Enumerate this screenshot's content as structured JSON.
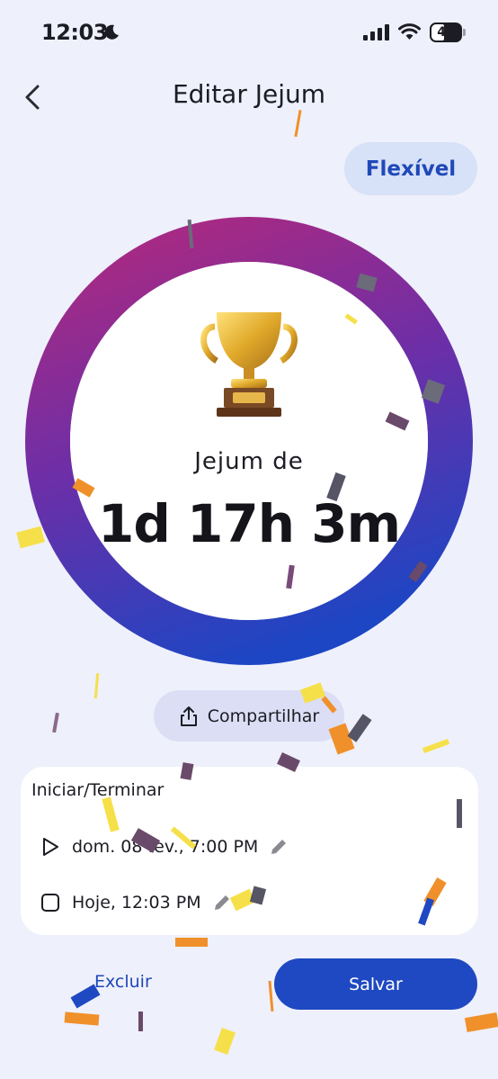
{
  "status_bar": {
    "time": "12:03",
    "battery": "40",
    "icons": [
      "moon-icon",
      "signal-icon",
      "wifi-icon",
      "battery-icon"
    ]
  },
  "header": {
    "title": "Editar Jejum",
    "back_icon": "chevron-left-icon"
  },
  "mode": {
    "label": "Flexível"
  },
  "ring": {
    "progress_fraction": 1.0,
    "gradient_colors": [
      "#a42a85",
      "#6b2fa8",
      "#1c46c4"
    ]
  },
  "summary": {
    "trophy_icon": "trophy-icon",
    "label": "Jejum de",
    "duration": "1d 17h 3m"
  },
  "share": {
    "label": "Compartilhar",
    "icon": "share-icon"
  },
  "times_card": {
    "title": "Iniciar/Terminar",
    "start": {
      "icon": "play-icon",
      "value": "dom. 08 fev., 7:00 PM",
      "edit_icon": "pencil-icon"
    },
    "end": {
      "icon": "square-icon",
      "value": "Hoje, 12:03 PM",
      "edit_icon": "pencil-icon"
    }
  },
  "actions": {
    "delete_label": "Excluir",
    "save_label": "Salvar"
  },
  "colors": {
    "background": "#eef0fb",
    "accent": "#1f49c2",
    "pill": "#d7e1f7"
  }
}
